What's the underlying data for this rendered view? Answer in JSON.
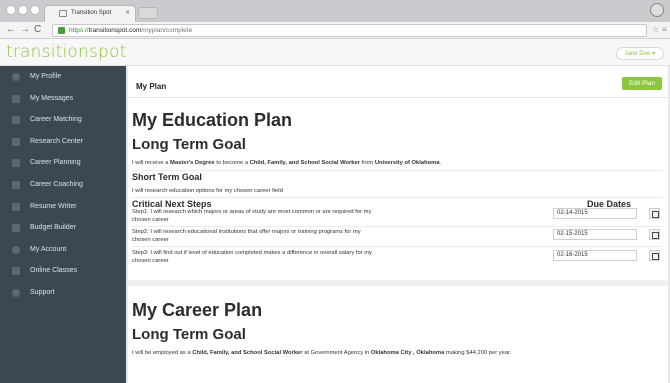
{
  "browser": {
    "tab_title": "Transition Spot",
    "tab_close": "×",
    "url_scheme": "https://",
    "url_host": "transitionspot.com",
    "url_path": "/myplan/complete"
  },
  "app": {
    "logo": "transitionspot",
    "user_menu": "Jane Doe ▾"
  },
  "sidebar": {
    "items": [
      {
        "label": "My Profile",
        "icon": "person-icon"
      },
      {
        "label": "My Messages",
        "icon": "envelope-icon"
      },
      {
        "label": "Career Matching",
        "icon": "crown-icon"
      },
      {
        "label": "Research Center",
        "icon": "crown-icon"
      },
      {
        "label": "Career Planning",
        "icon": "checklist-icon"
      },
      {
        "label": "Career Coaching",
        "icon": "checklist-icon"
      },
      {
        "label": "Resume Writer",
        "icon": "pencil-icon"
      },
      {
        "label": "Budget Builder",
        "icon": "bank-icon"
      },
      {
        "label": "My Account",
        "icon": "person-icon"
      },
      {
        "label": "Online Classes",
        "icon": "book-icon"
      },
      {
        "label": "Support",
        "icon": "help-icon"
      }
    ]
  },
  "plan": {
    "header": "My Plan",
    "edit_button": "Edit Plan",
    "education": {
      "title": "My Education Plan",
      "long_term_heading": "Long Term Goal",
      "long_term_parts": {
        "a": "I will receive a ",
        "b": "Master's Degree",
        "c": " to become a ",
        "d": "Child, Family, and School Social Worker",
        "e": " from ",
        "f": "University of Oklahoma",
        "g": "."
      },
      "short_term_heading": "Short Term Goal",
      "short_term_text": "I will research education options for my chosen career field",
      "steps_heading": "Critical Next Steps",
      "due_heading": "Due Dates",
      "steps": [
        {
          "text": "Step1: I will research which majors or areas of study are most common or are required for my chosen career",
          "date": "02-14-2015"
        },
        {
          "text": "Step2: I will research educational institutions that offer majors or training programs for my chosen career",
          "date": "02-15-2015"
        },
        {
          "text": "Step3: I will find out if level of education completed makes a difference in overall salary for my chosen career",
          "date": "02-16-2015"
        }
      ]
    },
    "career": {
      "title": "My Career Plan",
      "long_term_heading": "Long Term Goal",
      "long_term_parts": {
        "a": "I will be employed as a ",
        "b": "Child, Family, and School Social Worker",
        "c": " at Government Agency in ",
        "d": "Oklahoma City , Oklahoma",
        "e": " making $44,200 per year."
      }
    }
  },
  "colors": {
    "accent": "#8dc63f",
    "sidebar": "#3b4751"
  }
}
